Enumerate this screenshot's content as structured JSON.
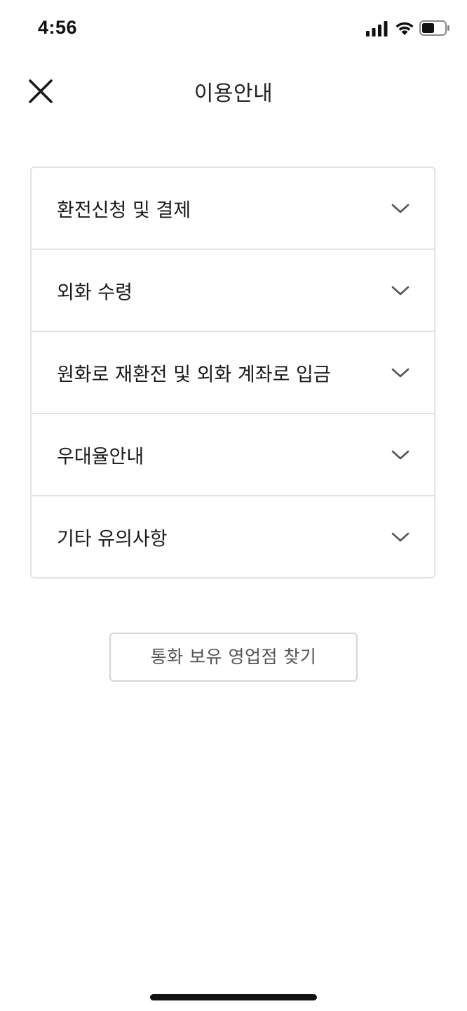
{
  "status_bar": {
    "time": "4:56",
    "icons": [
      "cellular-signal-icon",
      "wifi-icon",
      "battery-icon"
    ],
    "battery_level": 0.55
  },
  "header": {
    "title": "이용안내",
    "close_icon": "close-icon"
  },
  "accordion": {
    "items": [
      {
        "label": "환전신청 및 결제",
        "icon": "chevron-down-icon"
      },
      {
        "label": "외화 수령",
        "icon": "chevron-down-icon"
      },
      {
        "label": "원화로 재환전 및 외화 계좌로 입금",
        "icon": "chevron-down-icon"
      },
      {
        "label": "우대율안내",
        "icon": "chevron-down-icon"
      },
      {
        "label": "기타 유의사항",
        "icon": "chevron-down-icon"
      }
    ]
  },
  "find_branch_button": {
    "label": "통화 보유 영업점 찾기"
  },
  "colors": {
    "background": "#ffffff",
    "text_primary": "#1a1a1a",
    "border": "#e3e3e3",
    "chevron": "#555555",
    "button_text": "#555555"
  }
}
